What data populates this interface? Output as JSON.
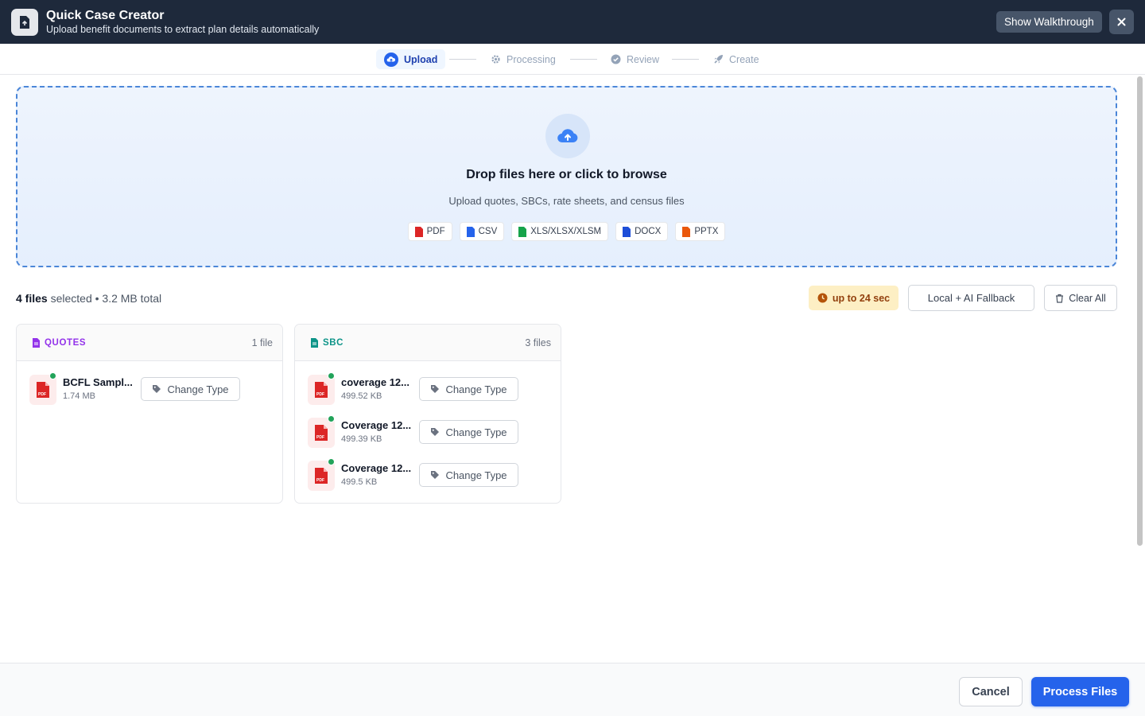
{
  "header": {
    "title": "Quick Case Creator",
    "subtitle": "Upload benefit documents to extract plan details automatically",
    "walkthrough_label": "Show Walkthrough",
    "close_icon": "close-icon",
    "app_icon": "document-upload-icon"
  },
  "stepper": {
    "steps": [
      {
        "label": "Upload",
        "icon": "cloud-upload-icon",
        "active": true
      },
      {
        "label": "Processing",
        "icon": "gear-icon",
        "active": false
      },
      {
        "label": "Review",
        "icon": "check-circle-icon",
        "active": false
      },
      {
        "label": "Create",
        "icon": "rocket-icon",
        "active": false
      }
    ]
  },
  "dropzone": {
    "title": "Drop files here or click to browse",
    "subtitle": "Upload quotes, SBCs, rate sheets, and census files",
    "types": [
      {
        "label": "PDF",
        "color": "#dc2626"
      },
      {
        "label": "CSV",
        "color": "#2563eb"
      },
      {
        "label": "XLS/XLSX/XLSM",
        "color": "#16a34a"
      },
      {
        "label": "DOCX",
        "color": "#1d4ed8"
      },
      {
        "label": "PPTX",
        "color": "#ea580c"
      }
    ]
  },
  "summary": {
    "count_label": "4 files",
    "selected_text": " selected • 3.2 MB total",
    "time_label": "up to 24 sec",
    "mode_label": "Local + AI Fallback",
    "clear_label": "Clear All"
  },
  "groups": [
    {
      "label": "QUOTES",
      "count": "1 file",
      "color": "#9333ea",
      "files": [
        {
          "name": "BCFL Sampl...",
          "size": "1.74 MB",
          "action": "Change Type"
        }
      ]
    },
    {
      "label": "SBC",
      "count": "3 files",
      "color": "#0d9488",
      "files": [
        {
          "name": "coverage 12...",
          "size": "499.52 KB",
          "action": "Change Type"
        },
        {
          "name": "Coverage 12...",
          "size": "499.39 KB",
          "action": "Change Type"
        },
        {
          "name": "Coverage 12...",
          "size": "499.5 KB",
          "action": "Change Type"
        }
      ]
    }
  ],
  "footer": {
    "cancel_label": "Cancel",
    "process_label": "Process Files"
  },
  "colors": {
    "accent": "#2563eb",
    "header_bg": "#1e293b",
    "success": "#22a35a",
    "pdf": "#dc2626"
  }
}
